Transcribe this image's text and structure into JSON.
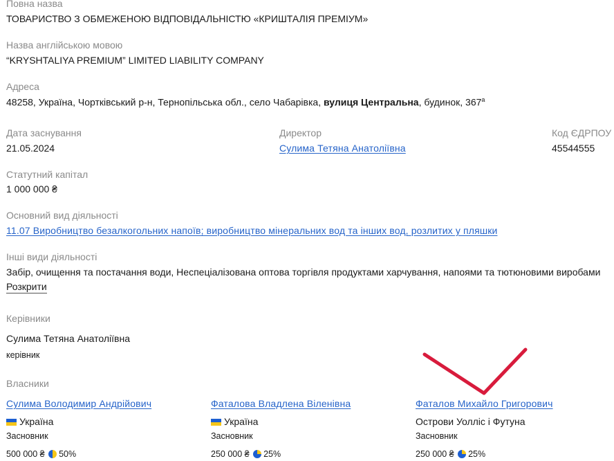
{
  "full_name": {
    "label": "Повна назва",
    "value": "ТОВАРИСТВО З ОБМЕЖЕНОЮ ВІДПОВІДАЛЬНІСТЮ «КРИШТАЛІЯ ПРЕМІУМ»"
  },
  "english_name": {
    "label": "Назва англійською мовою",
    "value": "“KRYSHTALIYA PREMIUM” LIMITED LIABILITY COMPANY"
  },
  "address": {
    "label": "Адреса",
    "part1": "48258, Україна, Чортківський р-н, Тернопільська обл., село Чабарівка, ",
    "street": "вулиця Центральна",
    "part2": ", будинок, 367",
    "sup": "а"
  },
  "founded": {
    "label": "Дата заснування",
    "value": "21.05.2024"
  },
  "director": {
    "label": "Директор",
    "value": "Сулима Тетяна Анатоліївна"
  },
  "edrpou": {
    "label": "Код ЄДРПОУ",
    "value": "45544555"
  },
  "capital": {
    "label": "Статутний капітал",
    "value": "1 000 000 ₴"
  },
  "main_activity": {
    "label": "Основний вид діяльності",
    "value": "11.07 Виробництво безалкогольних напоїв; виробництво мінеральних вод та інших вод, розлитих у пляшки"
  },
  "other_activities": {
    "label": "Інші види діяльності",
    "value": "Забір, очищення та постачання води, Неспеціалізована оптова торгівля продуктами харчування, напоями та тютюновими виробами",
    "expand_label": "Розкрити"
  },
  "managers": {
    "label": "Керівники",
    "items": [
      {
        "name": "Сулима Тетяна Анатоліївна",
        "role": "керівник"
      }
    ]
  },
  "owners": {
    "label": "Власники",
    "items": [
      {
        "name": "Сулима Володимир Андрійович",
        "country": "Україна",
        "flag": "ukraine-flag-icon",
        "role": "Засновник",
        "amount": "500 000 ₴",
        "share": "50%",
        "share_fraction": 0.5
      },
      {
        "name": "Фаталова Владлена Віленівна",
        "country": "Україна",
        "flag": "ukraine-flag-icon",
        "role": "Засновник",
        "amount": "250 000 ₴",
        "share": "25%",
        "share_fraction": 0.25
      },
      {
        "name": "Фаталов Михайло Григорович",
        "country": "Острови Уолліс і Футуна",
        "flag": null,
        "role": "Засновник",
        "amount": "250 000 ₴",
        "share": "25%",
        "share_fraction": 0.25
      }
    ]
  },
  "colors": {
    "link": "#2563c9",
    "label": "#8a8a8a",
    "flag_blue": "#1d5fd1",
    "flag_yellow": "#f5c518",
    "annotation_mark": "#d81b3c"
  }
}
